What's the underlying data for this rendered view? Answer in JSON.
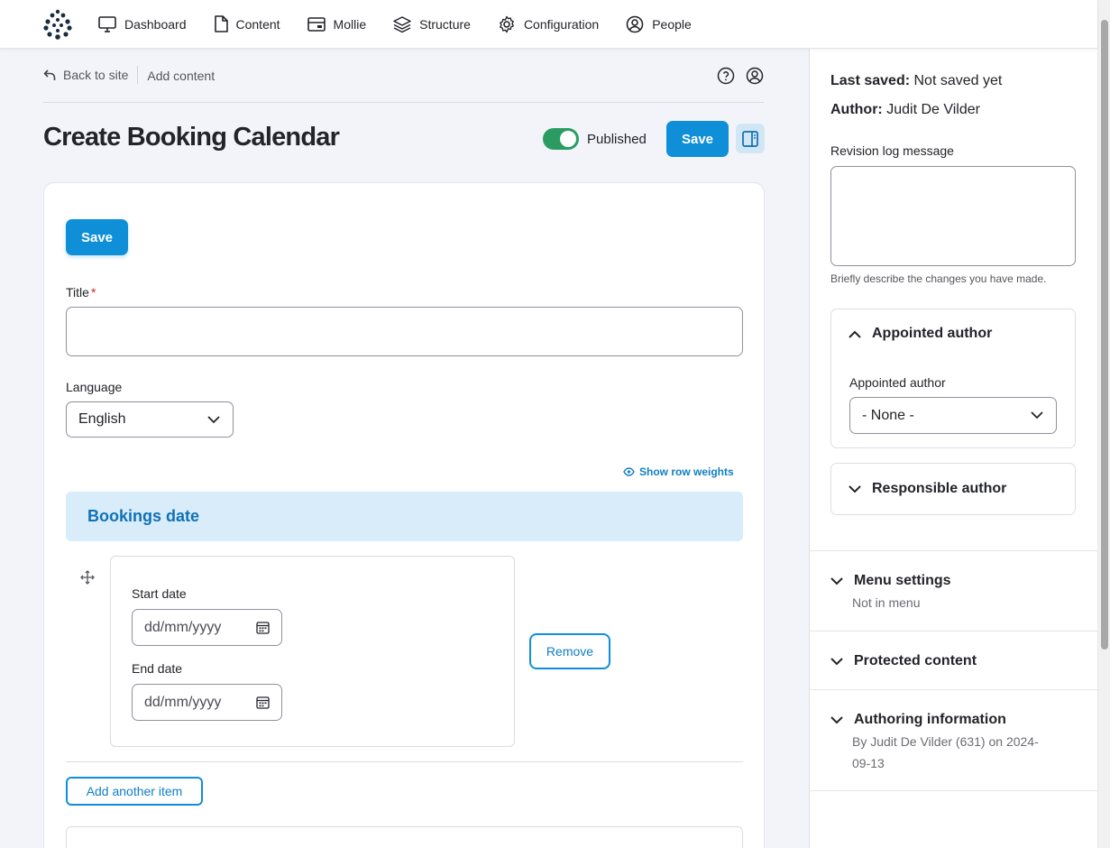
{
  "nav": {
    "items": [
      {
        "label": "Dashboard",
        "icon": "monitor-icon"
      },
      {
        "label": "Content",
        "icon": "file-icon"
      },
      {
        "label": "Mollie",
        "icon": "credit-card-icon"
      },
      {
        "label": "Structure",
        "icon": "layers-icon"
      },
      {
        "label": "Configuration",
        "icon": "gear-icon"
      },
      {
        "label": "People",
        "icon": "user-circle-icon"
      }
    ]
  },
  "breadcrumb": {
    "back_label": "Back to site",
    "current": "Add content"
  },
  "page": {
    "title": "Create Booking Calendar",
    "published_label": "Published",
    "published": true,
    "save_label": "Save"
  },
  "form": {
    "save_label": "Save",
    "title_label": "Title",
    "title_required_mark": "*",
    "title_value": "",
    "language_label": "Language",
    "language_value": "English",
    "row_weights_label": "Show row weights",
    "field_heading": "Bookings date",
    "start_date_label": "Start date",
    "start_date_placeholder": "dd/mm/yyyy",
    "end_date_label": "End date",
    "end_date_placeholder": "dd/mm/yyyy",
    "remove_label": "Remove",
    "add_item_label": "Add another item"
  },
  "sidebar": {
    "last_saved_label": "Last saved:",
    "last_saved_value": "Not saved yet",
    "author_label": "Author:",
    "author_value": "Judit De Vilder",
    "revision_label": "Revision log message",
    "revision_value": "",
    "revision_help": "Briefly describe the changes you have made.",
    "appointed_author": {
      "heading": "Appointed author",
      "field_label": "Appointed author",
      "value": "- None -"
    },
    "responsible_author": {
      "heading": "Responsible author"
    },
    "menu_settings": {
      "heading": "Menu settings",
      "summary": "Not in menu"
    },
    "protected_content": {
      "heading": "Protected content"
    },
    "authoring_information": {
      "heading": "Authoring information",
      "summary_line1": "By Judit De Vilder (631) on 2024-",
      "summary_line2": "09-13"
    }
  },
  "colors": {
    "accent": "#0f8fd8",
    "toggle_on": "#2a9c62",
    "field_heading_bg": "#d8ecf9",
    "required": "#d72222"
  }
}
